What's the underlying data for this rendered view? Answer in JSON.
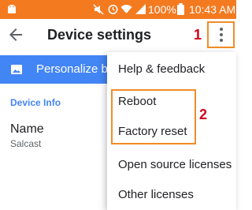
{
  "status_bar": {
    "battery_text": "100%",
    "time": "10:43 AM",
    "icons": [
      "android-icon",
      "mute-icon",
      "alarm-icon",
      "wifi-icon",
      "signal-icon",
      "battery-icon"
    ],
    "bg_color": "#f47a20"
  },
  "app_bar": {
    "title": "Device settings",
    "annotation": "1",
    "icons": [
      "back-arrow-icon",
      "overflow-menu-icon"
    ]
  },
  "banner": {
    "text": "Personalize bac",
    "icon": "wallpaper-icon",
    "bg_color": "#4285f4"
  },
  "device_info": {
    "header": "Device Info",
    "name_label": "Name",
    "name_value": "Salcast"
  },
  "menu": {
    "items": [
      "Help & feedback",
      "Reboot",
      "Factory reset",
      "Open source licenses",
      "Other licenses"
    ],
    "annotation": "2"
  },
  "annotations": {
    "color": "#d0021b",
    "box_color": "#f28c28"
  }
}
